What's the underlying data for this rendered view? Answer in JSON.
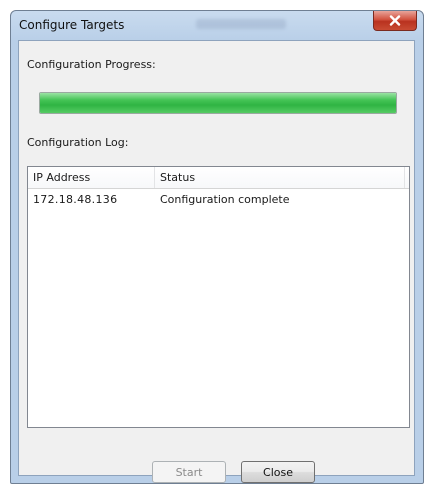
{
  "window": {
    "title": "Configure Targets"
  },
  "progress": {
    "label": "Configuration Progress:",
    "value_percent": 100,
    "color": "#3fbf4f"
  },
  "log": {
    "label": "Configuration Log:",
    "columns": [
      "IP Address",
      "Status"
    ],
    "rows": [
      {
        "ip": "172.18.48.136",
        "status": "Configuration complete"
      }
    ]
  },
  "buttons": {
    "start_label": "Start",
    "start_enabled": false,
    "close_label": "Close"
  },
  "icons": {
    "titlebar_close": "close-icon"
  },
  "colors": {
    "titlebar_close_red": "#c94b33",
    "window_frame": "#b9cfe8"
  }
}
